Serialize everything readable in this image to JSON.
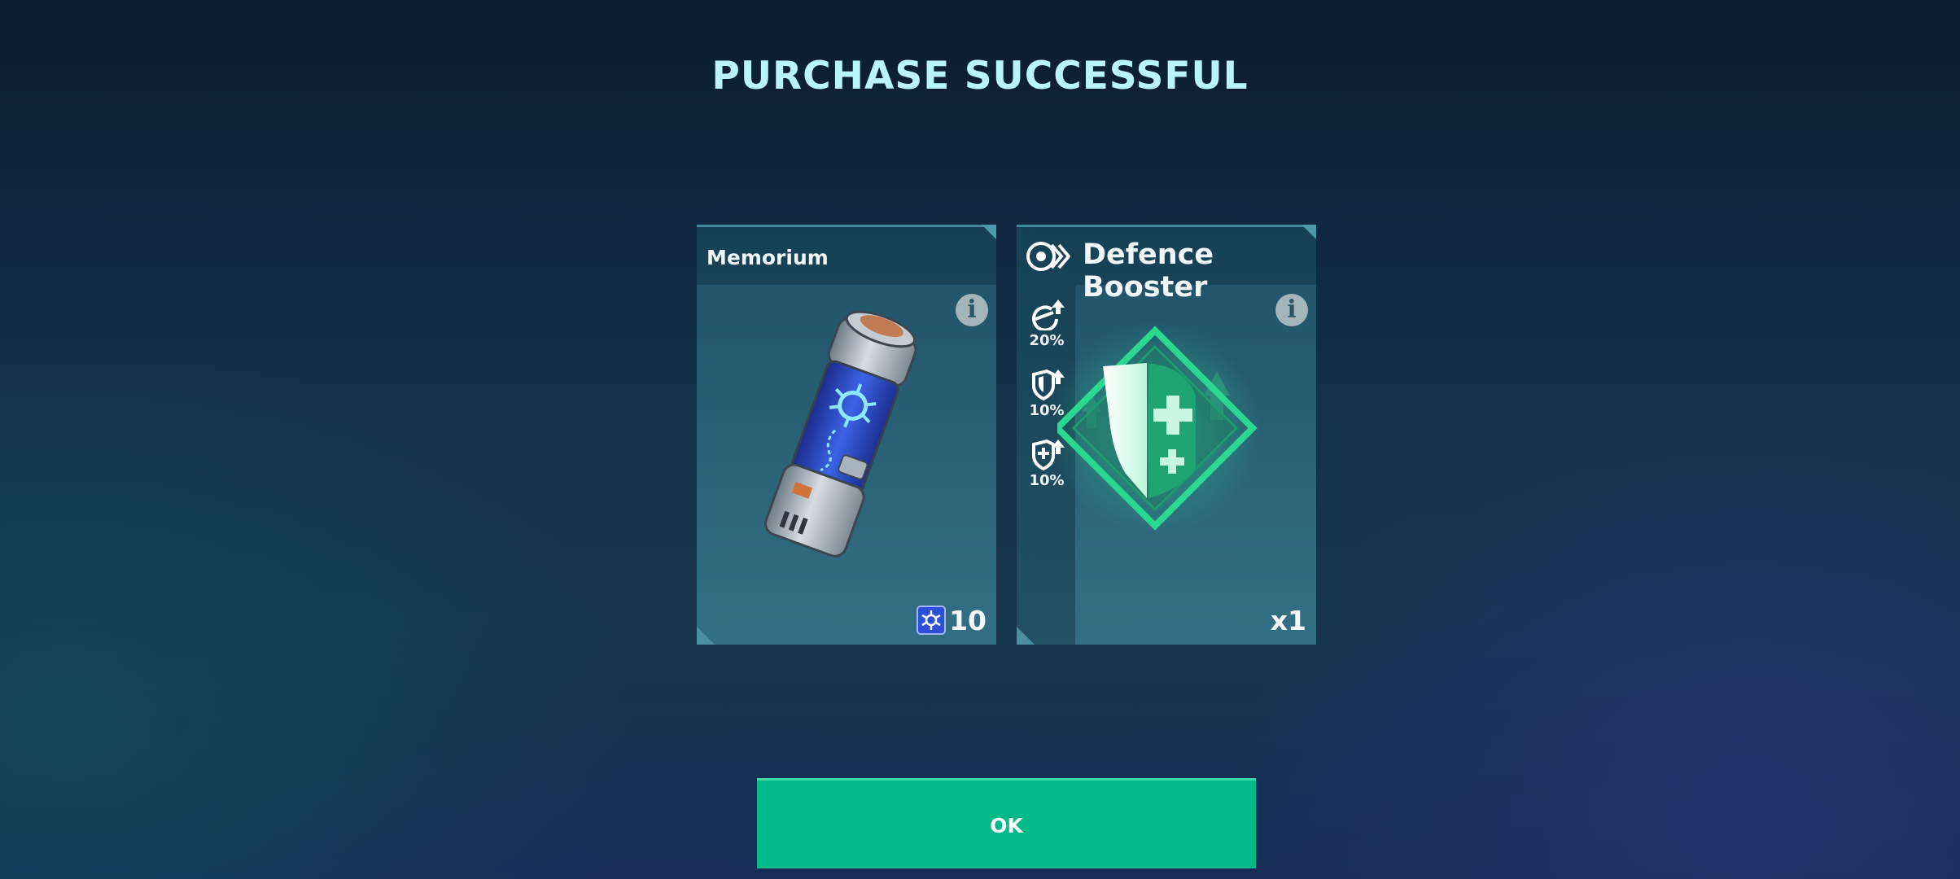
{
  "title": "PURCHASE SUCCESSFUL",
  "cards": [
    {
      "name": "Memorium",
      "info_icon": "info-icon",
      "resource_icon": "memorium-currency-icon",
      "count": "10",
      "image": "memorium-canister-icon"
    },
    {
      "name": "Defence Booster",
      "header_icon": "booster-type-icon",
      "info_icon": "info-icon",
      "count": "x1",
      "image": "defence-booster-shield-icon",
      "stats": [
        {
          "icon": "dodge-up-icon",
          "value": "20%"
        },
        {
          "icon": "shield-up-icon",
          "value": "10%"
        },
        {
          "icon": "health-shield-up-icon",
          "value": "10%"
        }
      ]
    }
  ],
  "ok_button": {
    "label": "OK"
  },
  "colors": {
    "title": "#b9f4fb",
    "button": "#00bb89",
    "accent_green": "#2bd88f"
  }
}
